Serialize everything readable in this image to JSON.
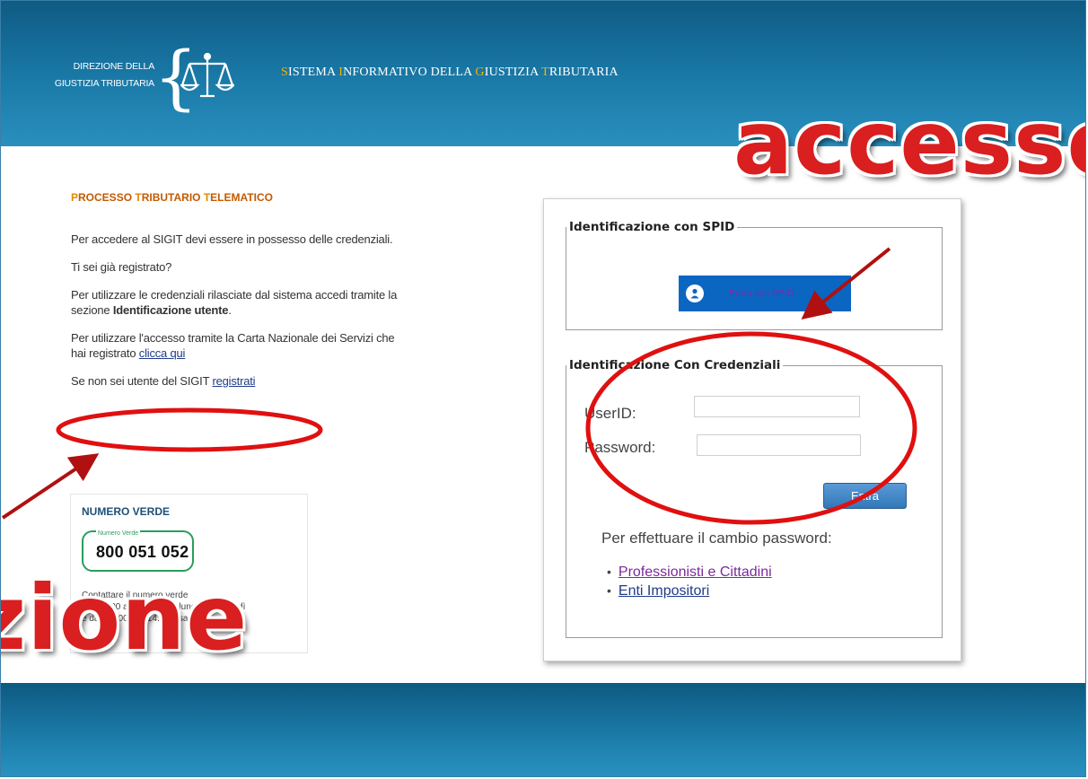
{
  "header": {
    "org_line1": "DIREZIONE DELLA",
    "org_line2": "GIUSTIZIA TRIBUTARIA",
    "system_name": {
      "w1_first": "S",
      "w1_rest": "ISTEMA ",
      "w2_first": "I",
      "w2_rest": "NFORMATIVO DELLA ",
      "w3_first": "G",
      "w3_rest": "IUSTIZIA ",
      "w4_first": "T",
      "w4_rest": "RIBUTARIA"
    },
    "logo_icon": "scales-of-justice-icon"
  },
  "overlay": {
    "top_word": "accesso",
    "bottom_word": "zione"
  },
  "left": {
    "section_title": {
      "w1_first": "P",
      "w1_rest": "ROCESSO ",
      "w2_first": "T",
      "w2_rest": "RIBUTARIO ",
      "w3_first": "T",
      "w3_rest": "ELEMATICO"
    },
    "p1": "Per accedere al SIGIT devi essere in possesso delle credenziali.",
    "p2": "Ti sei già registrato?",
    "p3_a": "Per utilizzare le credenziali rilasciate dal sistema accedi tramite la sezione ",
    "p3_b": "Identificazione utente",
    "p3_c": ".",
    "p4": "Per utilizzare l'accesso tramite la Carta Nazionale dei Servizi che hai registrato ",
    "p4_link": "clicca qui",
    "p5": "Se non sei utente del SIGIT ",
    "p5_link": "registrati"
  },
  "numero_verde": {
    "title": "NUMERO VERDE",
    "badge_label": "Numero Verde",
    "number": "800 051 052",
    "text_line1": "Contattare il numero verde",
    "text_line2": "dalle 8.00 alle 18.00 dal lunedì al venerdì",
    "text_line3": "e dalle 8.00 alle 14.00 il sabato"
  },
  "login": {
    "spid_legend": "Identificazione con SPID",
    "spid_button": "Entra con SPID",
    "cred_legend": "Identificazione Con Credenziali",
    "userid_label": "UserID:",
    "password_label": "Password:",
    "userid_value": "",
    "password_value": "",
    "enter_button": "Entra",
    "change_password_text": "Per effettuare il cambio password:",
    "links": [
      "Professionisti e Cittadini",
      "Enti Impositori"
    ]
  },
  "colors": {
    "header_blue": "#1a7aa8",
    "annotation_red": "#d91f1f",
    "accent_orange": "#e08a00",
    "spid_blue": "#0b66c2"
  }
}
